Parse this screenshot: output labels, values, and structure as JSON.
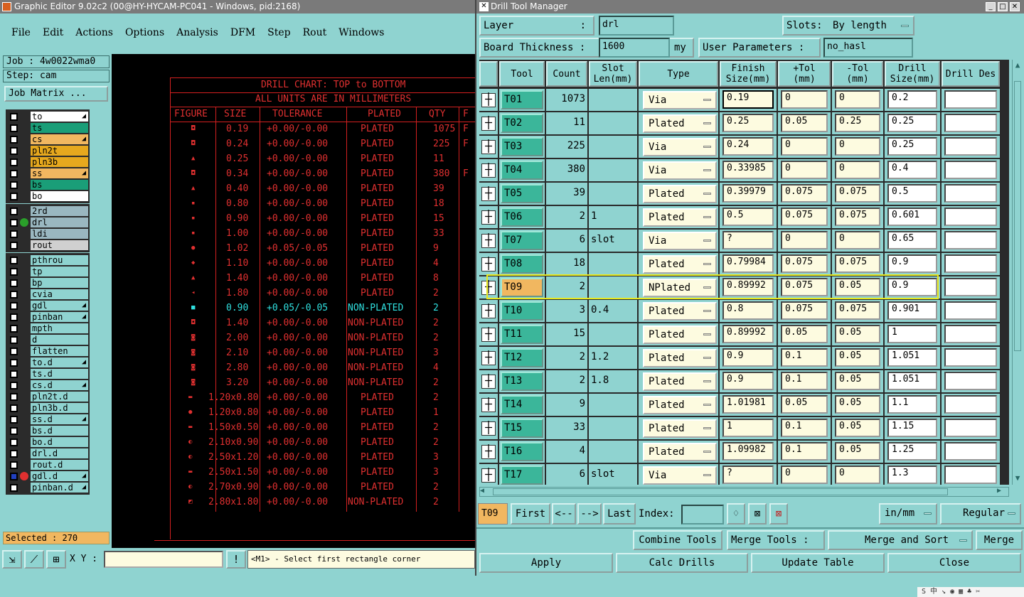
{
  "main_window": {
    "title": "Graphic Editor 9.02c2 (00@HY-HYCAM-PC041 - Windows, pid:2168)",
    "menu": [
      "File",
      "Edit",
      "Actions",
      "Options",
      "Analysis",
      "DFM",
      "Step",
      "Rout",
      "Windows"
    ],
    "job": "Job : 4w0022wma0",
    "step": "Step: cam",
    "job_matrix_label": "Job Matrix ...",
    "layer_groups": [
      [
        {
          "name": "to",
          "color": "#ffffff",
          "mark": "◢"
        },
        {
          "name": "ts",
          "color": "#1a9e78",
          "mark": ""
        },
        {
          "name": "cs",
          "color": "#f1b760",
          "mark": "◢"
        },
        {
          "name": "pln2t",
          "color": "#e6a81e",
          "mark": ""
        },
        {
          "name": "pln3b",
          "color": "#e6a81e",
          "mark": ""
        },
        {
          "name": "ss",
          "color": "#f1b760",
          "mark": "◢"
        },
        {
          "name": "bs",
          "color": "#1a9e78",
          "mark": ""
        },
        {
          "name": "bo",
          "color": "#ffffff",
          "mark": ""
        }
      ],
      [
        {
          "name": "2rd",
          "color": "#9ab7c0",
          "mark": ""
        },
        {
          "name": "drl",
          "color": "#9ab7c0",
          "mark": "",
          "active": true
        },
        {
          "name": "ldi",
          "color": "#9ab7c0",
          "mark": ""
        },
        {
          "name": "rout",
          "color": "#d0d0d0",
          "mark": ""
        }
      ],
      [
        {
          "name": "pthrou",
          "color": "#8fd3d0",
          "mark": ""
        },
        {
          "name": "tp",
          "color": "#8fd3d0",
          "mark": ""
        },
        {
          "name": "bp",
          "color": "#8fd3d0",
          "mark": ""
        },
        {
          "name": "cvia",
          "color": "#8fd3d0",
          "mark": ""
        },
        {
          "name": "gdl",
          "color": "#8fd3d0",
          "mark": "◢"
        },
        {
          "name": "pinban",
          "color": "#8fd3d0",
          "mark": "◢"
        },
        {
          "name": "mpth",
          "color": "#8fd3d0",
          "mark": ""
        },
        {
          "name": "d",
          "color": "#8fd3d0",
          "mark": ""
        },
        {
          "name": "flatten",
          "color": "#8fd3d0",
          "mark": ""
        },
        {
          "name": "to.d",
          "color": "#8fd3d0",
          "mark": "◢"
        },
        {
          "name": "ts.d",
          "color": "#8fd3d0",
          "mark": ""
        },
        {
          "name": "cs.d",
          "color": "#8fd3d0",
          "mark": "◢"
        },
        {
          "name": "pln2t.d",
          "color": "#8fd3d0",
          "mark": ""
        },
        {
          "name": "pln3b.d",
          "color": "#8fd3d0",
          "mark": ""
        },
        {
          "name": "ss.d",
          "color": "#8fd3d0",
          "mark": "◢"
        },
        {
          "name": "bs.d",
          "color": "#8fd3d0",
          "mark": ""
        },
        {
          "name": "bo.d",
          "color": "#8fd3d0",
          "mark": ""
        },
        {
          "name": "drl.d",
          "color": "#8fd3d0",
          "mark": ""
        },
        {
          "name": "rout.d",
          "color": "#8fd3d0",
          "mark": ""
        },
        {
          "name": "gdl.d",
          "color": "#8fd3d0",
          "mark": "◢",
          "special": true
        },
        {
          "name": "pinban.d",
          "color": "#8fd3d0",
          "mark": "◢"
        }
      ]
    ],
    "selected": "Selected : 270",
    "xy_label": "X Y :",
    "prompt": "<M1> - Select first rectangle corner"
  },
  "drill_chart": {
    "title1": "DRILL CHART: TOP to BOTTOM",
    "title2": "ALL UNITS ARE IN MILLIMETERS",
    "headers": [
      "FIGURE",
      "SIZE",
      "TOLERANCE",
      "PLATED",
      "QTY",
      "F"
    ],
    "rows": [
      {
        "fig": "◘",
        "size": "0.19",
        "tol": "+0.00/-0.00",
        "plated": "PLATED",
        "qty": "1075",
        "extra": "F"
      },
      {
        "fig": "◘",
        "size": "0.24",
        "tol": "+0.00/-0.00",
        "plated": "PLATED",
        "qty": "225",
        "extra": "F"
      },
      {
        "fig": "▲",
        "size": "0.25",
        "tol": "+0.00/-0.00",
        "plated": "PLATED",
        "qty": "11",
        "extra": ""
      },
      {
        "fig": "◘",
        "size": "0.34",
        "tol": "+0.00/-0.00",
        "plated": "PLATED",
        "qty": "380",
        "extra": "F"
      },
      {
        "fig": "▲",
        "size": "0.40",
        "tol": "+0.00/-0.00",
        "plated": "PLATED",
        "qty": "39",
        "extra": ""
      },
      {
        "fig": "▪",
        "size": "0.80",
        "tol": "+0.00/-0.00",
        "plated": "PLATED",
        "qty": "18",
        "extra": ""
      },
      {
        "fig": "▪",
        "size": "0.90",
        "tol": "+0.00/-0.00",
        "plated": "PLATED",
        "qty": "15",
        "extra": ""
      },
      {
        "fig": "▪",
        "size": "1.00",
        "tol": "+0.00/-0.00",
        "plated": "PLATED",
        "qty": "33",
        "extra": ""
      },
      {
        "fig": "●",
        "size": "1.02",
        "tol": "+0.05/-0.05",
        "plated": "PLATED",
        "qty": "9",
        "extra": ""
      },
      {
        "fig": "◆",
        "size": "1.10",
        "tol": "+0.00/-0.00",
        "plated": "PLATED",
        "qty": "4",
        "extra": ""
      },
      {
        "fig": "▲",
        "size": "1.40",
        "tol": "+0.00/-0.00",
        "plated": "PLATED",
        "qty": "8",
        "extra": ""
      },
      {
        "fig": "◂",
        "size": "1.80",
        "tol": "+0.00/-0.00",
        "plated": "PLATED",
        "qty": "2",
        "extra": ""
      },
      {
        "fig": "■",
        "size": "0.90",
        "tol": "+0.05/-0.05",
        "plated": "NON-PLATED",
        "qty": "2",
        "extra": "",
        "cyan": true
      },
      {
        "fig": "◘",
        "size": "1.40",
        "tol": "+0.00/-0.00",
        "plated": "NON-PLATED",
        "qty": "2",
        "extra": ""
      },
      {
        "fig": "◙",
        "size": "2.00",
        "tol": "+0.00/-0.00",
        "plated": "NON-PLATED",
        "qty": "2",
        "extra": ""
      },
      {
        "fig": "◙",
        "size": "2.10",
        "tol": "+0.00/-0.00",
        "plated": "NON-PLATED",
        "qty": "3",
        "extra": ""
      },
      {
        "fig": "◙",
        "size": "2.80",
        "tol": "+0.00/-0.00",
        "plated": "NON-PLATED",
        "qty": "4",
        "extra": ""
      },
      {
        "fig": "◙",
        "size": "3.20",
        "tol": "+0.00/-0.00",
        "plated": "NON-PLATED",
        "qty": "2",
        "extra": ""
      },
      {
        "fig": "▬",
        "size": "1.20x0.80",
        "tol": "+0.00/-0.00",
        "plated": "PLATED",
        "qty": "2",
        "extra": ""
      },
      {
        "fig": "●",
        "size": "1.20x0.80",
        "tol": "+0.00/-0.00",
        "plated": "PLATED",
        "qty": "1",
        "extra": ""
      },
      {
        "fig": "▬",
        "size": "1.50x0.50",
        "tol": "+0.00/-0.00",
        "plated": "PLATED",
        "qty": "2",
        "extra": ""
      },
      {
        "fig": "◐",
        "size": "2.10x0.90",
        "tol": "+0.00/-0.00",
        "plated": "PLATED",
        "qty": "2",
        "extra": ""
      },
      {
        "fig": "◐",
        "size": "2.50x1.20",
        "tol": "+0.00/-0.00",
        "plated": "PLATED",
        "qty": "3",
        "extra": ""
      },
      {
        "fig": "▬",
        "size": "2.50x1.50",
        "tol": "+0.00/-0.00",
        "plated": "PLATED",
        "qty": "3",
        "extra": ""
      },
      {
        "fig": "◐",
        "size": "2.70x0.90",
        "tol": "+0.00/-0.00",
        "plated": "PLATED",
        "qty": "2",
        "extra": ""
      },
      {
        "fig": "◩",
        "size": "2.80x1.80",
        "tol": "+0.00/-0.00",
        "plated": "NON-PLATED",
        "qty": "2",
        "extra": ""
      }
    ]
  },
  "dtm": {
    "title": "Drill Tool Manager",
    "layer_label": "Layer",
    "layer_colon": ":",
    "layer_value": "drl",
    "slots_label": "Slots:",
    "slots_value": "By length",
    "board_thickness_label": "Board Thickness :",
    "board_thickness_value": "1600",
    "board_thickness_unit": "my",
    "user_params_label": "User Parameters :",
    "user_params_value": "no_hasl",
    "columns": [
      "Tool",
      "Count",
      "Slot Len(mm)",
      "Type",
      "Finish Size(mm)",
      "+Tol (mm)",
      "-Tol (mm)",
      "Drill Size(mm)",
      "Drill Des"
    ],
    "tools": [
      {
        "id": "T01",
        "count": "1073",
        "slot": "",
        "type": "Via",
        "finish": "0.19",
        "ptol": "0",
        "ntol": "0",
        "drill": "0.2",
        "des": "",
        "icon": "┼"
      },
      {
        "id": "T02",
        "count": "11",
        "slot": "",
        "type": "Plated",
        "finish": "0.25",
        "ptol": "0.05",
        "ntol": "0.25",
        "drill": "0.25",
        "des": "",
        "icon": "┼"
      },
      {
        "id": "T03",
        "count": "225",
        "slot": "",
        "type": "Via",
        "finish": "0.24",
        "ptol": "0",
        "ntol": "0",
        "drill": "0.25",
        "des": "",
        "icon": "┼"
      },
      {
        "id": "T04",
        "count": "380",
        "slot": "",
        "type": "Via",
        "finish": "0.33985",
        "ptol": "0",
        "ntol": "0",
        "drill": "0.4",
        "des": "",
        "icon": "┼"
      },
      {
        "id": "T05",
        "count": "39",
        "slot": "",
        "type": "Plated",
        "finish": "0.39979",
        "ptol": "0.075",
        "ntol": "0.075",
        "drill": "0.5",
        "des": "",
        "icon": "┼"
      },
      {
        "id": "T06",
        "count": "2",
        "slot": "1",
        "type": "Plated",
        "finish": "0.5",
        "ptol": "0.075",
        "ntol": "0.075",
        "drill": "0.601",
        "des": "",
        "icon": "┼"
      },
      {
        "id": "T07",
        "count": "6",
        "slot": "slot",
        "type": "Via",
        "finish": "?",
        "ptol": "0",
        "ntol": "0",
        "drill": "0.65",
        "des": "",
        "icon": "┼"
      },
      {
        "id": "T08",
        "count": "18",
        "slot": "",
        "type": "Plated",
        "finish": "0.79984",
        "ptol": "0.075",
        "ntol": "0.075",
        "drill": "0.9",
        "des": "",
        "icon": "┼"
      },
      {
        "id": "T09",
        "count": "2",
        "slot": "",
        "type": "NPlated",
        "finish": "0.89992",
        "ptol": "0.075",
        "ntol": "0.05",
        "drill": "0.9",
        "des": "",
        "icon": "┼",
        "selected": true
      },
      {
        "id": "T10",
        "count": "3",
        "slot": "0.4",
        "type": "Plated",
        "finish": "0.8",
        "ptol": "0.075",
        "ntol": "0.075",
        "drill": "0.901",
        "des": "",
        "icon": "┼"
      },
      {
        "id": "T11",
        "count": "15",
        "slot": "",
        "type": "Plated",
        "finish": "0.89992",
        "ptol": "0.05",
        "ntol": "0.05",
        "drill": "1",
        "des": "",
        "icon": "┼"
      },
      {
        "id": "T12",
        "count": "2",
        "slot": "1.2",
        "type": "Plated",
        "finish": "0.9",
        "ptol": "0.1",
        "ntol": "0.05",
        "drill": "1.051",
        "des": "",
        "icon": "┼"
      },
      {
        "id": "T13",
        "count": "2",
        "slot": "1.8",
        "type": "Plated",
        "finish": "0.9",
        "ptol": "0.1",
        "ntol": "0.05",
        "drill": "1.051",
        "des": "",
        "icon": "┼"
      },
      {
        "id": "T14",
        "count": "9",
        "slot": "",
        "type": "Plated",
        "finish": "1.01981",
        "ptol": "0.05",
        "ntol": "0.05",
        "drill": "1.1",
        "des": "",
        "icon": "┼"
      },
      {
        "id": "T15",
        "count": "33",
        "slot": "",
        "type": "Plated",
        "finish": "1",
        "ptol": "0.1",
        "ntol": "0.05",
        "drill": "1.15",
        "des": "",
        "icon": "┼"
      },
      {
        "id": "T16",
        "count": "4",
        "slot": "",
        "type": "Plated",
        "finish": "1.09982",
        "ptol": "0.1",
        "ntol": "0.05",
        "drill": "1.25",
        "des": "",
        "icon": "┼"
      },
      {
        "id": "T17",
        "count": "6",
        "slot": "slot",
        "type": "Via",
        "finish": "?",
        "ptol": "0",
        "ntol": "0",
        "drill": "1.3",
        "des": "",
        "icon": "┼"
      }
    ],
    "current_tool": "T09",
    "first_label": "First",
    "prev_label": "<--",
    "next_label": "-->",
    "last_label": "Last",
    "index_label": "Index:",
    "units_value": "in/mm",
    "mode_value": "Regular",
    "combine_label": "Combine Tools",
    "merge_tools_label": "Merge Tools :",
    "merge_mode_value": "Merge and Sort",
    "merge_label": "Merge",
    "apply_label": "Apply",
    "calc_label": "Calc Drills",
    "update_label": "Update Table",
    "close_label": "Close"
  },
  "tray_text": "S 中 ↘ ◉ ▦ ♣ ✂"
}
